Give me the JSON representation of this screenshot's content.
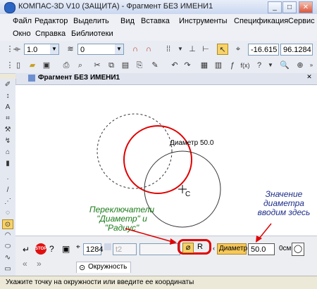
{
  "window": {
    "title": "КОМПАС-3D V10 (ЗАЩИТА) - Фрагмент БЕЗ ИМЕНИ1"
  },
  "menu": {
    "row1": [
      "Файл",
      "Редактор",
      "Выделить",
      "Вид",
      "Вставка",
      "Инструменты",
      "Спецификация",
      "Сервис"
    ],
    "row2": [
      "Окно",
      "Справка",
      "Библиотеки"
    ]
  },
  "toolbar1": {
    "line_scale": "1.0",
    "layer": "0",
    "coord_x": "-16.615",
    "coord_y": "96.1284"
  },
  "document": {
    "tab_title": "Фрагмент БЕЗ ИМЕНИ1"
  },
  "canvas": {
    "diameter_label": "Диаметр 50.0",
    "center_label": "С"
  },
  "properties": {
    "field_1": "1284",
    "field_2": "t2",
    "toggle_diameter": "⌀",
    "toggle_radius": "R",
    "param_label": "Диаметр",
    "param_value": "50.0",
    "style_label": "0см",
    "tab_label": "Окружность"
  },
  "annotations": {
    "switches": "Переключатели \"Диаметр\" и \"Радиус\"",
    "enter": "Значение диаметра вводим здесь"
  },
  "status": {
    "text": "Укажите точку на окружности или введите ее координаты"
  },
  "colors": {
    "accent_red": "#e00000",
    "annotation_green": "#1a7a1a",
    "annotation_blue": "#1e2e8a"
  }
}
